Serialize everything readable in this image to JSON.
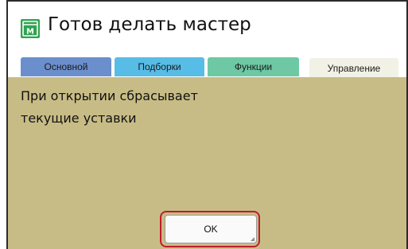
{
  "header": {
    "title": "Готов делать мастер",
    "status_icon": "master-sheet-icon",
    "status_icon_color": "#2ea44f",
    "status_icon_letter": "М"
  },
  "tabs": [
    {
      "label": "Основной",
      "color": "#6b8fcc",
      "active": false
    },
    {
      "label": "Подборки",
      "color": "#58bde6",
      "active": false
    },
    {
      "label": "Функции",
      "color": "#6dc8a3",
      "active": false
    },
    {
      "label": "Управление",
      "color": "#f2f1e6",
      "active": true
    }
  ],
  "panel": {
    "background": "#c8bc86",
    "message_lines": [
      "При открытии сбрасывает",
      "текущие уставки"
    ]
  },
  "dialog": {
    "ok_label": "OK",
    "focus_color": "#c21b2e"
  }
}
